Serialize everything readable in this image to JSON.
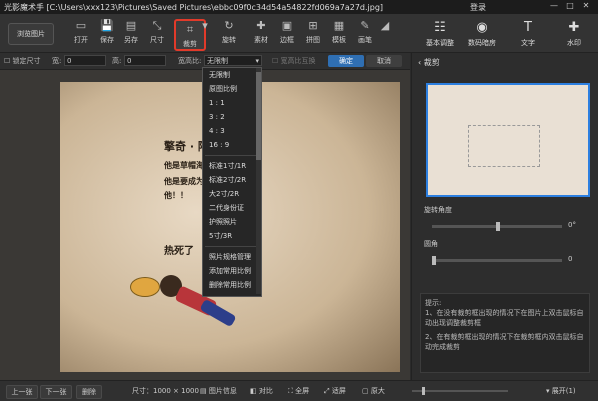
{
  "titlebar": {
    "app": "光影魔术手",
    "path": "[C:\\Users\\xxx123\\Pictures\\Saved Pictures\\ebbc09f0c34d54a54822fd069a7a27d.jpg]",
    "login": "登录",
    "min": "—",
    "max": "□",
    "close": "✕"
  },
  "toolbar": {
    "browse": "浏览图片",
    "items": [
      {
        "label": "打开",
        "icon": "▭"
      },
      {
        "label": "保存",
        "icon": "💾"
      },
      {
        "label": "另存",
        "icon": "▤"
      },
      {
        "label": "尺寸",
        "icon": "⤡"
      },
      {
        "label": "裁剪",
        "icon": "⌗"
      },
      {
        "label": "旋转",
        "icon": "↻"
      },
      {
        "label": "素材",
        "icon": "✚"
      },
      {
        "label": "边框",
        "icon": "▣"
      },
      {
        "label": "拼图",
        "icon": "⊞"
      },
      {
        "label": "模板",
        "icon": "▦"
      },
      {
        "label": "画笔",
        "icon": "✎"
      }
    ],
    "right": [
      {
        "label": "基本调整",
        "icon": "☷"
      },
      {
        "label": "数码暗房",
        "icon": "◉"
      },
      {
        "label": "文字",
        "icon": "T"
      },
      {
        "label": "水印",
        "icon": "✚"
      }
    ]
  },
  "optbar": {
    "lock": "锁定尺寸",
    "width_label": "宽:",
    "width_value": "0",
    "height_label": "高:",
    "height_value": "0",
    "ratio_label": "宽高比:",
    "ratio_value": "无限制",
    "swap": "宽高比互换",
    "ok": "确定",
    "cancel": "取消"
  },
  "dropdown": {
    "items": [
      "无限制",
      "原图比例",
      "1 : 1",
      "3 : 2",
      "4 : 3",
      "16 : 9"
    ],
    "items2": [
      "标准1寸/1R",
      "标准2寸/2R",
      "大2寸/2R",
      "二代身份证",
      "护照照片",
      "5寸/3R"
    ],
    "items3": [
      "照片规格管理",
      "添加常用比例",
      "删除常用比例"
    ]
  },
  "photo": {
    "line1": "擎奇 · 阿飞",
    "line2": "他是草帽海",
    "line3": "他是要成为",
    "line4": "他！！",
    "line5": "热死了"
  },
  "panel": {
    "title": "裁剪",
    "rotate_label": "旋转角度",
    "rotate_value": "0°",
    "round_label": "圆角",
    "round_value": "0",
    "hint_title": "提示:",
    "hint1": "1、在没有裁剪框出现的情况下在图片上双击鼠标自动出现调整裁剪框",
    "hint2": "2、在有裁剪框出现的情况下在裁剪框内双击鼠标自动完成裁剪"
  },
  "statusbar": {
    "prev": "上一张",
    "next": "下一张",
    "delete": "删除",
    "size": "尺寸：1000 × 1000",
    "info": "图片信息",
    "compare": "对比",
    "full": "全屏",
    "fit": "适屏",
    "orig": "原大",
    "expand": "展开(1)"
  }
}
